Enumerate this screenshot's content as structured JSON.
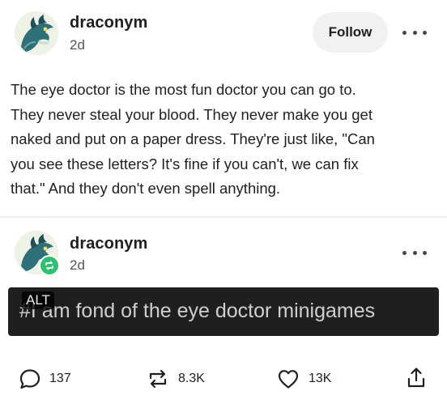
{
  "post": {
    "username": "draconym",
    "time": "2d",
    "follow_label": "Follow",
    "more_icon": "more-horizontal-icon",
    "text_lines": [
      "The eye doctor is the most fun doctor you can go to.",
      "They never steal your blood. They never make you get",
      "naked and put on a paper dress. They're just like, \"Can",
      "you see these letters? It's fine if you can't, we can fix",
      "that.\" And they don't even spell anything."
    ]
  },
  "reblog": {
    "username": "draconym",
    "time": "2d",
    "badge_icon": "reblog-icon",
    "image_text": "#I am fond of the eye doctor minigames",
    "alt_label": "ALT"
  },
  "footer": {
    "replies": "137",
    "reblogs": "8.3K",
    "likes": "13K"
  },
  "colors": {
    "reblog_badge": "#2fbf71",
    "follow_bg": "#f1f1f1",
    "image_bg": "#1f1f1f"
  }
}
